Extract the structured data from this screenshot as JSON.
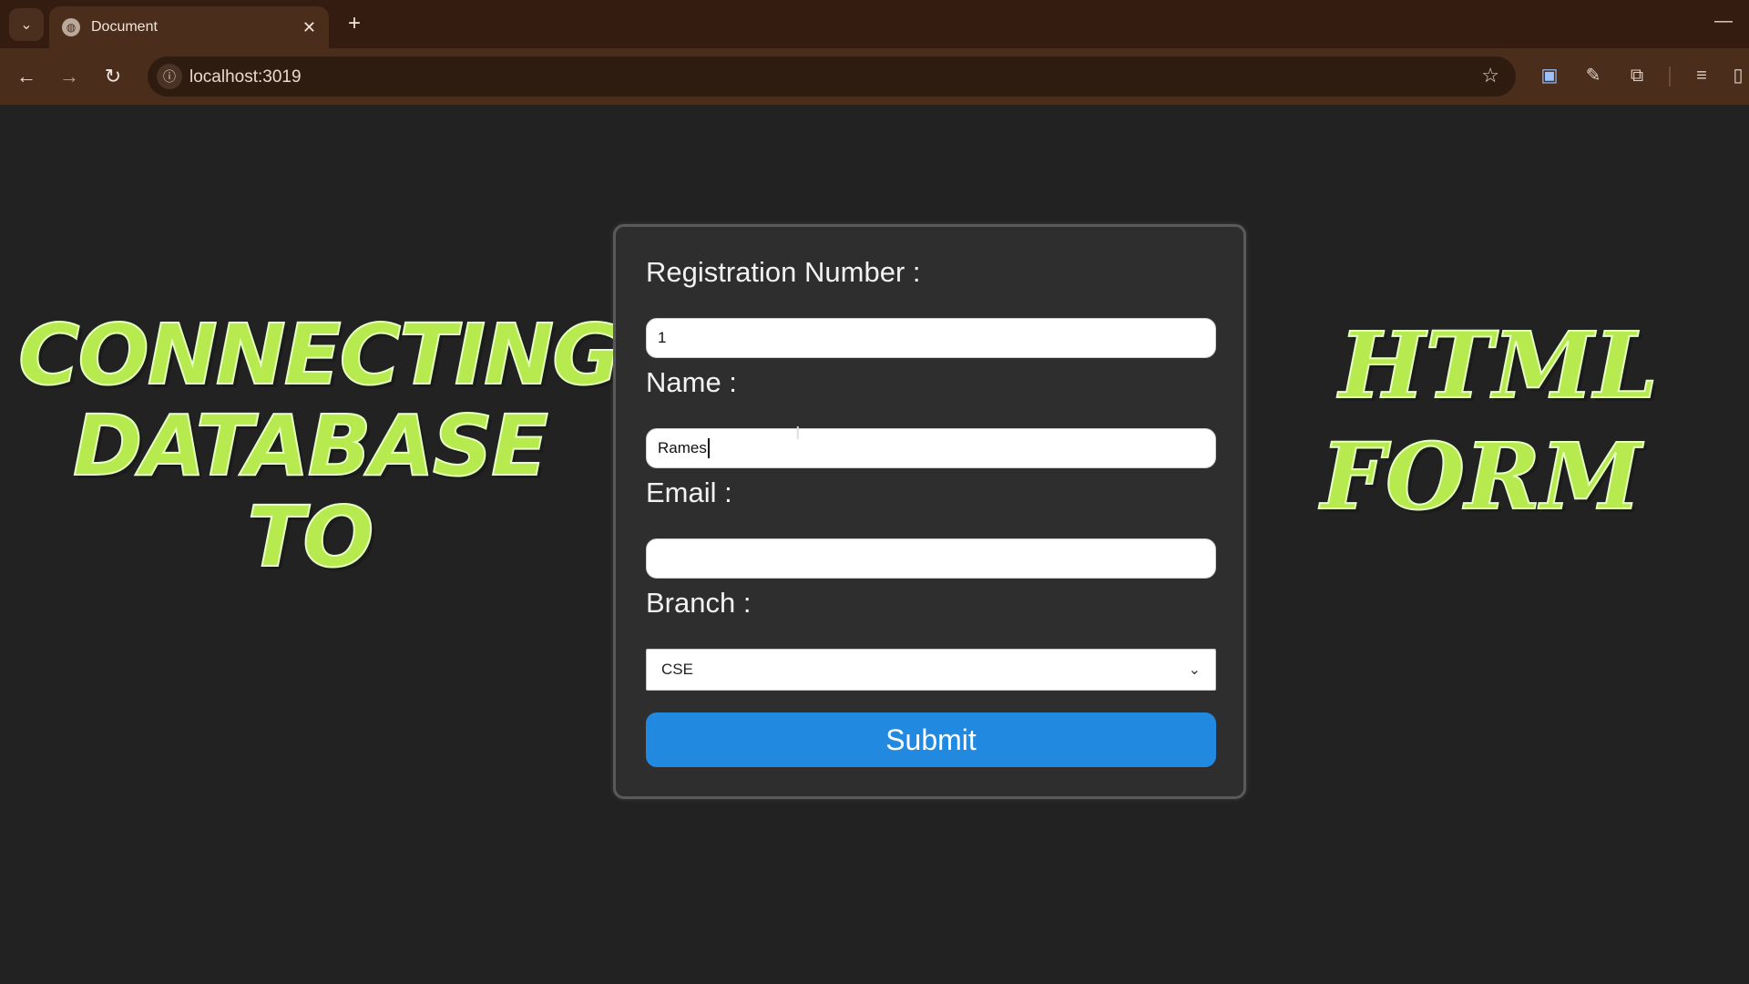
{
  "browser": {
    "tab_title": "Document",
    "tab_close": "✕",
    "new_tab": "+",
    "url": "localhost:3019",
    "minimize": "—"
  },
  "headline": {
    "left_lines": [
      "CONNECTING",
      "DATABASE",
      "TO"
    ],
    "right_lines": [
      "HTML",
      "FORM"
    ],
    "color": "#b6ea4e"
  },
  "form": {
    "registration_label": "Registration Number :",
    "registration_value": "1",
    "name_label": "Name :",
    "name_value": "Rames",
    "email_label": "Email :",
    "email_value": "",
    "branch_label": "Branch :",
    "branch_selected": "CSE",
    "submit_label": "Submit",
    "accent_color": "#2189e0"
  },
  "icons": {
    "tab_search": "chevron-down-icon",
    "back": "back-arrow-icon",
    "forward": "forward-arrow-icon",
    "reload": "reload-icon",
    "site_info": "info-icon",
    "bookmark": "star-icon",
    "extensions": [
      "screencast-icon",
      "eyedropper-icon",
      "puzzle-icon",
      "media-control-icon",
      "sidepanel-icon"
    ]
  }
}
